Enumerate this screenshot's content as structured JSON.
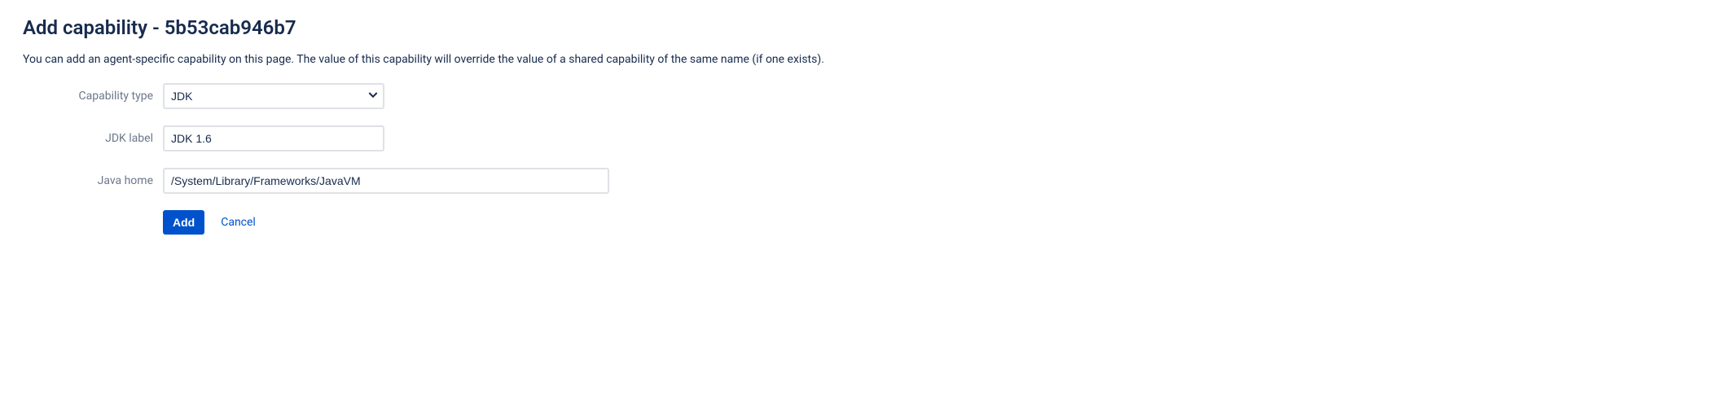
{
  "header": {
    "title": "Add capability - 5b53cab946b7"
  },
  "description": "You can add an agent-specific capability on this page. The value of this capability will override the value of a shared capability of the same name (if one exists).",
  "form": {
    "capability_type": {
      "label": "Capability type",
      "value": "JDK"
    },
    "jdk_label": {
      "label": "JDK label",
      "value": "JDK 1.6"
    },
    "java_home": {
      "label": "Java home",
      "value": "/System/Library/Frameworks/JavaVM"
    }
  },
  "actions": {
    "add_label": "Add",
    "cancel_label": "Cancel"
  }
}
